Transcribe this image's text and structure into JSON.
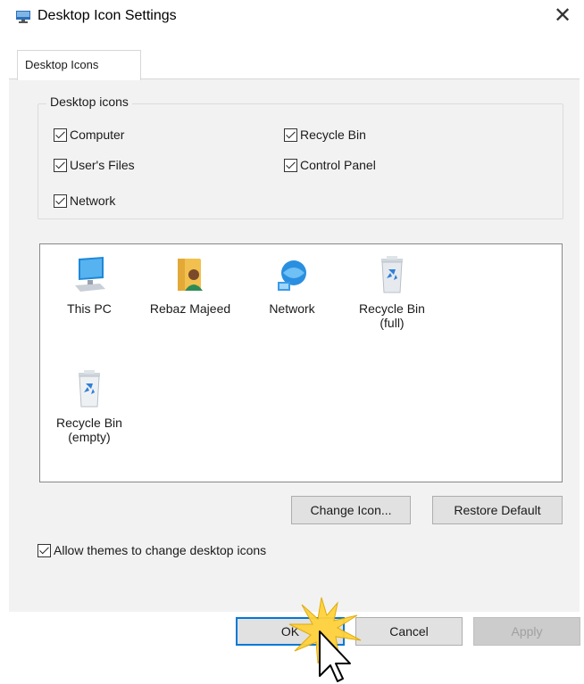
{
  "window": {
    "title": "Desktop Icon Settings",
    "close_label": "✕"
  },
  "tabs": [
    {
      "label": "Desktop Icons"
    }
  ],
  "group": {
    "legend": "Desktop icons",
    "checkboxes": [
      {
        "label": "Computer",
        "checked": true
      },
      {
        "label": "Recycle Bin",
        "checked": true
      },
      {
        "label": "User's Files",
        "checked": true
      },
      {
        "label": "Control Panel",
        "checked": true
      },
      {
        "label": "Network",
        "checked": true
      }
    ]
  },
  "icon_list": {
    "items": [
      {
        "label": "This PC",
        "icon": "computer-icon"
      },
      {
        "label": "Rebaz Majeed",
        "icon": "user-folder-icon"
      },
      {
        "label": "Network",
        "icon": "network-icon"
      },
      {
        "label": "Recycle Bin\n(full)",
        "icon": "recycle-bin-full-icon"
      },
      {
        "label": "Recycle Bin\n(empty)",
        "icon": "recycle-bin-empty-icon"
      }
    ]
  },
  "buttons": {
    "change_icon": "Change Icon...",
    "restore_default": "Restore Default",
    "ok": "OK",
    "cancel": "Cancel",
    "apply": "Apply"
  },
  "allow_themes": {
    "label": "Allow themes to change desktop icons",
    "checked": true
  },
  "colors": {
    "accent": "#0078d7",
    "panel_bg": "#f2f2f2",
    "burst": "#ffd23c"
  }
}
